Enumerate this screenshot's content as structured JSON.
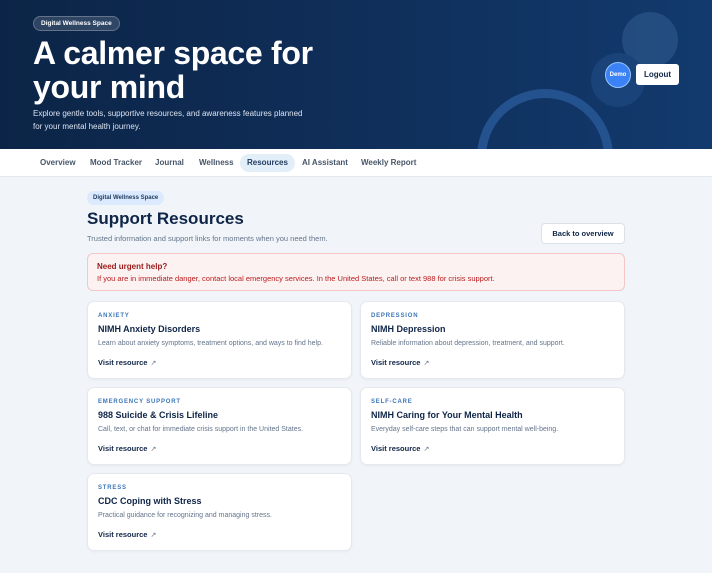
{
  "hero": {
    "badge": "Digital Wellness Space",
    "title": "A calmer space for your mind",
    "subtitle": "Explore gentle tools, supportive resources, and awareness features planned for your mental health journey.",
    "avatar_label": "Demo",
    "logout_label": "Logout"
  },
  "nav": {
    "tabs": [
      {
        "label": "Overview",
        "active": false
      },
      {
        "label": "Mood Tracker",
        "active": false
      },
      {
        "label": "Journal",
        "active": false
      },
      {
        "label": "Wellness",
        "active": false
      },
      {
        "label": "Resources",
        "active": true
      },
      {
        "label": "AI Assistant",
        "active": false
      },
      {
        "label": "Weekly Report",
        "active": false
      }
    ]
  },
  "page": {
    "badge": "Digital Wellness Space",
    "title": "Support Resources",
    "subtitle": "Trusted information and support links for moments when you need them.",
    "back_label": "Back to overview"
  },
  "urgent": {
    "title": "Need urgent help?",
    "text": "If you are in immediate danger, contact local emergency services. In the United States, call or text 988 for crisis support."
  },
  "resources": [
    {
      "category": "ANXIETY",
      "title": "NIMH Anxiety Disorders",
      "description": "Learn about anxiety symptoms, treatment options, and ways to find help.",
      "link_label": "Visit resource"
    },
    {
      "category": "DEPRESSION",
      "title": "NIMH Depression",
      "description": "Reliable information about depression, treatment, and support.",
      "link_label": "Visit resource"
    },
    {
      "category": "EMERGENCY SUPPORT",
      "title": "988 Suicide & Crisis Lifeline",
      "description": "Call, text, or chat for immediate crisis support in the United States.",
      "link_label": "Visit resource"
    },
    {
      "category": "SELF-CARE",
      "title": "NIMH Caring for Your Mental Health",
      "description": "Everyday self-care steps that can support mental well-being.",
      "link_label": "Visit resource"
    },
    {
      "category": "STRESS",
      "title": "CDC Coping with Stress",
      "description": "Practical guidance for recognizing and managing stress.",
      "link_label": "Visit resource"
    }
  ],
  "icons": {
    "external_link": "external-link-icon"
  },
  "colors": {
    "hero_bg": "#0f2d57",
    "accent": "#3b82f6",
    "urgent_bg": "#fdf2f2",
    "urgent_text": "#b91c1c"
  }
}
